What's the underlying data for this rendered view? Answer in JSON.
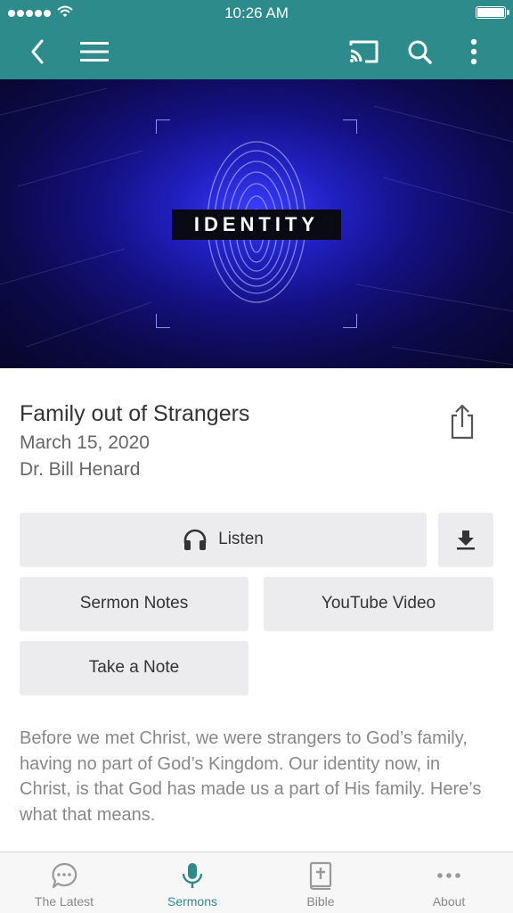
{
  "status": {
    "time": "10:26 AM"
  },
  "nav": {
    "icons": [
      "back-icon",
      "menu-icon",
      "cast-icon",
      "search-icon",
      "more-vertical-icon"
    ]
  },
  "hero": {
    "label": "IDENTITY"
  },
  "sermon": {
    "title": "Family out of Strangers",
    "date": "March 15, 2020",
    "speaker": "Dr. Bill Henard",
    "description": "Before we met Christ, we were strangers to God’s family, having no part of God’s Kingdom. Our identity now, in Christ, is that God has made us a part of His family. Here’s what that means."
  },
  "actions": {
    "listen": "Listen",
    "sermon_notes": "Sermon Notes",
    "youtube_video": "YouTube Video",
    "take_note": "Take a Note"
  },
  "tabs": [
    {
      "label": "The Latest",
      "icon": "chat-bubble-icon",
      "active": false
    },
    {
      "label": "Sermons",
      "icon": "microphone-icon",
      "active": true
    },
    {
      "label": "Bible",
      "icon": "bible-icon",
      "active": false
    },
    {
      "label": "About",
      "icon": "more-horizontal-icon",
      "active": false
    }
  ],
  "colors": {
    "accent": "#2e8b8b",
    "button_bg": "#ececef",
    "text_muted": "#888888"
  }
}
